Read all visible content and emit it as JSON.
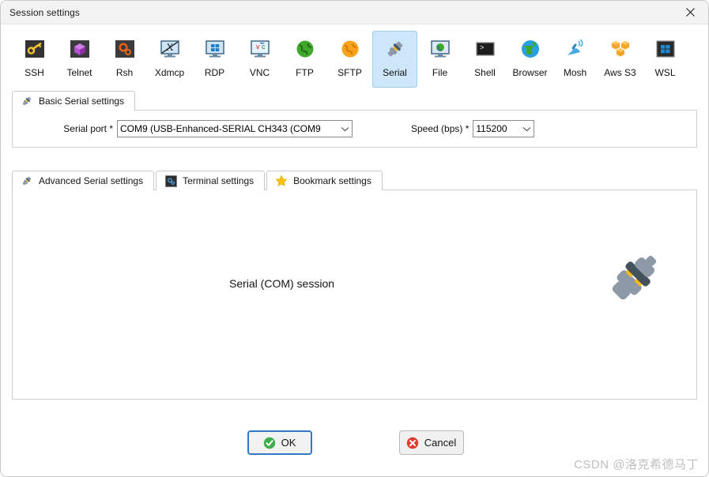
{
  "window": {
    "title": "Session settings",
    "close_label": "close-icon"
  },
  "session_types": [
    {
      "label": "SSH",
      "icon": "ssh-key-icon",
      "selected": false
    },
    {
      "label": "Telnet",
      "icon": "telnet-cube-icon",
      "selected": false
    },
    {
      "label": "Rsh",
      "icon": "rsh-gears-icon",
      "selected": false
    },
    {
      "label": "Xdmcp",
      "icon": "xdmcp-monitor-icon",
      "selected": false
    },
    {
      "label": "RDP",
      "icon": "rdp-monitor-icon",
      "selected": false
    },
    {
      "label": "VNC",
      "icon": "vnc-monitor-icon",
      "selected": false
    },
    {
      "label": "FTP",
      "icon": "ftp-globe-icon",
      "selected": false
    },
    {
      "label": "SFTP",
      "icon": "sftp-globe-icon",
      "selected": false
    },
    {
      "label": "Serial",
      "icon": "serial-plug-icon",
      "selected": true
    },
    {
      "label": "File",
      "icon": "file-monitor-icon",
      "selected": false
    },
    {
      "label": "Shell",
      "icon": "shell-prompt-icon",
      "selected": false
    },
    {
      "label": "Browser",
      "icon": "browser-globe-icon",
      "selected": false
    },
    {
      "label": "Mosh",
      "icon": "mosh-satellite-icon",
      "selected": false
    },
    {
      "label": "Aws S3",
      "icon": "aws-s3-boxes-icon",
      "selected": false
    },
    {
      "label": "WSL",
      "icon": "wsl-windows-icon",
      "selected": false
    }
  ],
  "basic_tab": {
    "label": "Basic Serial settings",
    "icon": "serial-plug-icon",
    "serial_port": {
      "label": "Serial port *",
      "value": "COM9  (USB-Enhanced-SERIAL CH343 (COM9"
    },
    "speed": {
      "label": "Speed (bps) *",
      "value": "115200"
    }
  },
  "lower_tabs": [
    {
      "label": "Advanced Serial settings",
      "icon": "serial-plug-icon",
      "active": true
    },
    {
      "label": "Terminal settings",
      "icon": "terminal-gears-icon",
      "active": false
    },
    {
      "label": "Bookmark settings",
      "icon": "star-icon",
      "active": false
    }
  ],
  "lower_body": {
    "session_caption": "Serial (COM) session",
    "illustration": "serial-plug-illustration"
  },
  "buttons": {
    "ok": {
      "label": "OK",
      "icon": "green-check-icon",
      "focused": true
    },
    "cancel": {
      "label": "Cancel",
      "icon": "red-cross-icon",
      "focused": false
    }
  },
  "watermark": {
    "text": "CSDN @洛克希德马丁"
  },
  "colors": {
    "selected_tab_bg": "#cde6f9",
    "selected_tab_border": "#9ccdee",
    "titlebar_bg": "#f3f3f3",
    "focus_border": "#3079c8",
    "ok_green": "#3eae49",
    "cancel_red": "#e03c31",
    "plug_grey": "#8d99a6",
    "plug_dark": "#4a5a66",
    "plug_yellow": "#f5b91a"
  }
}
